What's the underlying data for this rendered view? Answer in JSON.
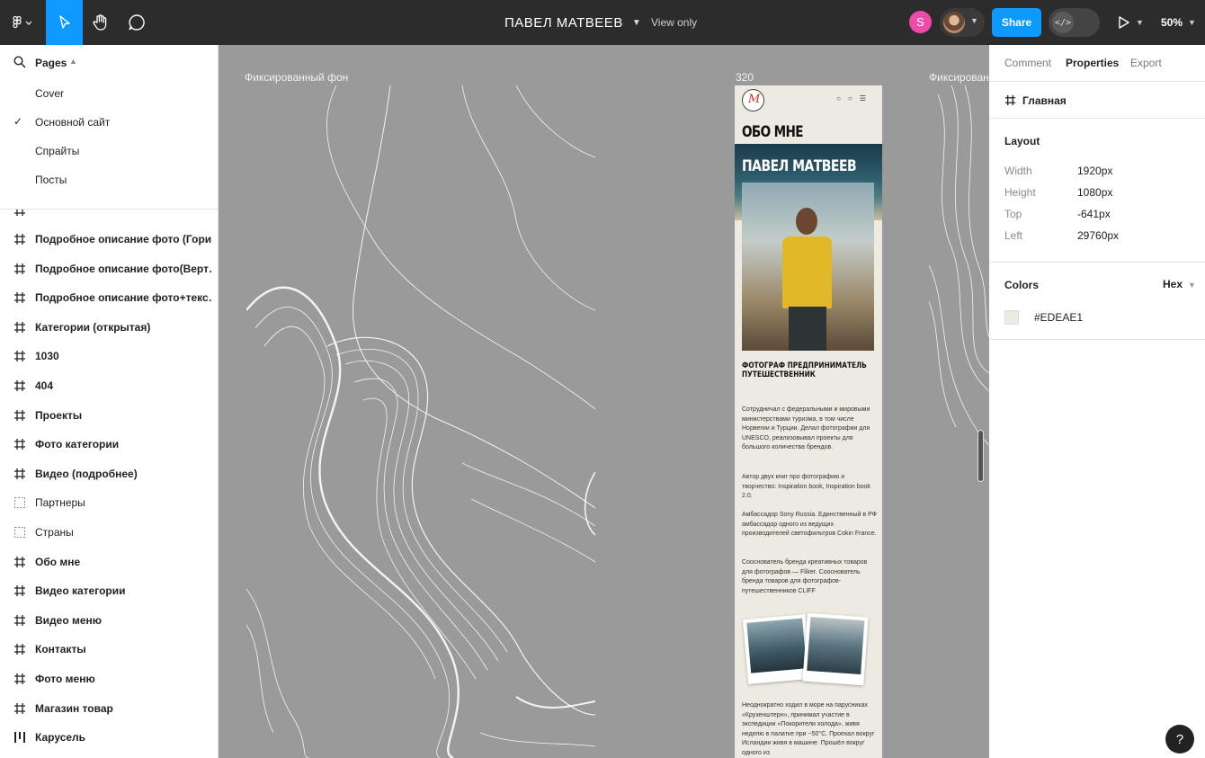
{
  "topbar": {
    "file_title": "ПАВЕЛ МАТВЕЕВ",
    "view_mode": "View only",
    "avatar_initial": "S",
    "share_label": "Share",
    "dev_mode_glyph": "</>",
    "zoom": "50%",
    "accent": "#0d99ff",
    "avatar_color": "#ec4ca7"
  },
  "pages": {
    "header": "Pages",
    "items": [
      {
        "label": "Cover",
        "selected": false
      },
      {
        "label": "Основной сайт",
        "selected": true
      },
      {
        "label": "Спрайты",
        "selected": false
      },
      {
        "label": "Посты",
        "selected": false
      }
    ]
  },
  "layers": [
    {
      "label": "Подробное описание фото (Гори…",
      "icon": "frame-icon"
    },
    {
      "label": "Подробное описание фото(Верт…",
      "icon": "frame-icon"
    },
    {
      "label": "Подробное описание фото+текс…",
      "icon": "frame-icon"
    },
    {
      "label": "Категории (открытая)",
      "icon": "frame-icon"
    },
    {
      "label": "1030",
      "icon": "frame-icon"
    },
    {
      "label": "404",
      "icon": "frame-icon"
    },
    {
      "label": "Проекты",
      "icon": "frame-icon"
    },
    {
      "label": "Фото категории",
      "icon": "frame-icon"
    },
    {
      "label": "Видео (подробнее)",
      "icon": "frame-icon"
    },
    {
      "label": "Партнеры",
      "icon": "section-icon"
    },
    {
      "label": "Страны",
      "icon": "section-icon"
    },
    {
      "label": "Обо мне",
      "icon": "frame-icon"
    },
    {
      "label": "Видео категории",
      "icon": "frame-icon"
    },
    {
      "label": "Видео меню",
      "icon": "frame-icon"
    },
    {
      "label": "Контакты",
      "icon": "frame-icon"
    },
    {
      "label": "Фото меню",
      "icon": "frame-icon"
    },
    {
      "label": "Магазин товар",
      "icon": "frame-icon"
    },
    {
      "label": "Карусель",
      "icon": "columns-icon"
    }
  ],
  "canvas": {
    "frame_label_1": "Фиксированный фон",
    "frame_label_2": "320",
    "frame_label_3": "Фиксированный фон",
    "mobile": {
      "heading": "ОБО МНЕ",
      "hero_title": "ПАВЕЛ МАТВЕЕВ",
      "subtitle": "ФОТОГРАФ ПРЕДПРИНИМАТЕЛЬ ПУТЕШЕСТВЕННИК",
      "paragraphs": [
        "Сотрудничал с федеральными и мировыми министерствами туризма, в том числе Норвегии и Турции. Делал фотографии для UNESCO, реализовывал проекты для большого количества брендов.",
        "Автор двух книг про фотографию и творчество: Inspiration book, Inspiration book 2.0.",
        "Амбассадор Sony Russia. Единственный в РФ амбассадор одного из ведущих производителей светофильтров Cokin France.",
        "Сооснователь бренда креативных товаров для фотографов — Fliker. Сооснователь бренда товаров для фотографов-путешественников CLIFF",
        "Неоднократно ходил в море на парусниках «Крузенштерн», принимал участие в экспедиции «Покорители холода», живя неделю в палатке при −50°С. Проехал вокруг Исландии живя в машине. Прошёл вокруг одного из"
      ]
    }
  },
  "properties": {
    "tabs": [
      "Comment",
      "Properties",
      "Export"
    ],
    "active_tab": "Properties",
    "frame_name": "Главная",
    "layout_title": "Layout",
    "layout": [
      {
        "key": "Width",
        "value": "1920px"
      },
      {
        "key": "Height",
        "value": "1080px"
      },
      {
        "key": "Top",
        "value": "-641px"
      },
      {
        "key": "Left",
        "value": "29760px"
      }
    ],
    "colors_title": "Colors",
    "color_format": "Hex",
    "color_value": "#EDEAE1"
  },
  "help_label": "?"
}
